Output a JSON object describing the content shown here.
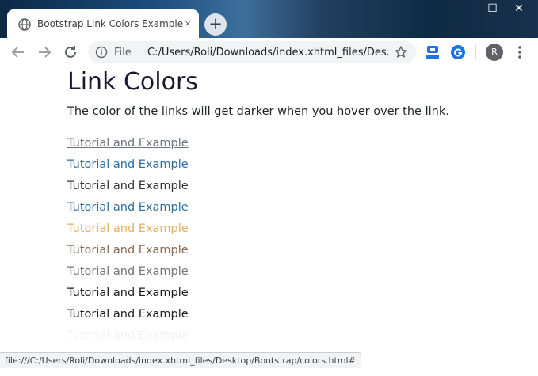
{
  "window": {
    "tab_title": "Bootstrap Link Colors Example",
    "tab_close": "×",
    "new_tab": "+",
    "controls": {
      "minimize": "—",
      "maximize": "☐",
      "close": "✕"
    }
  },
  "toolbar": {
    "scheme_label": "File",
    "url": "C:/Users/Roli/Downloads/index.xhtml_files/Des...",
    "avatar_initial": "R",
    "icons": [
      "back-arrow-icon",
      "forward-arrow-icon",
      "reload-icon",
      "info-icon",
      "star-icon",
      "extension-icon",
      "grammarly-icon",
      "kebab-menu-icon"
    ]
  },
  "page": {
    "title": "Link Colors",
    "lead": "The color of the links will get darker when you hover over the link.",
    "links": [
      {
        "text": "Tutorial and Example",
        "color": "#6c757d",
        "state": "hovered-underlined"
      },
      {
        "text": "Tutorial and Example",
        "color": "#2e6da4"
      },
      {
        "text": "Tutorial and Example",
        "color": "#333333"
      },
      {
        "text": "Tutorial and Example",
        "color": "#2e6da4"
      },
      {
        "text": "Tutorial and Example",
        "color": "#e0b25c"
      },
      {
        "text": "Tutorial and Example",
        "color": "#8a6a55"
      },
      {
        "text": "Tutorial and Example",
        "color": "#757575"
      },
      {
        "text": "Tutorial and Example",
        "color": "#1a1a1a"
      },
      {
        "text": "Tutorial and Example",
        "color": "#222222"
      },
      {
        "text": "Tutorial and Example",
        "color": "#f2f2f2"
      }
    ]
  },
  "status": {
    "text": "file:///C:/Users/Roli/Downloads/index.xhtml_files/Desktop/Bootstrap/colors.html#"
  }
}
